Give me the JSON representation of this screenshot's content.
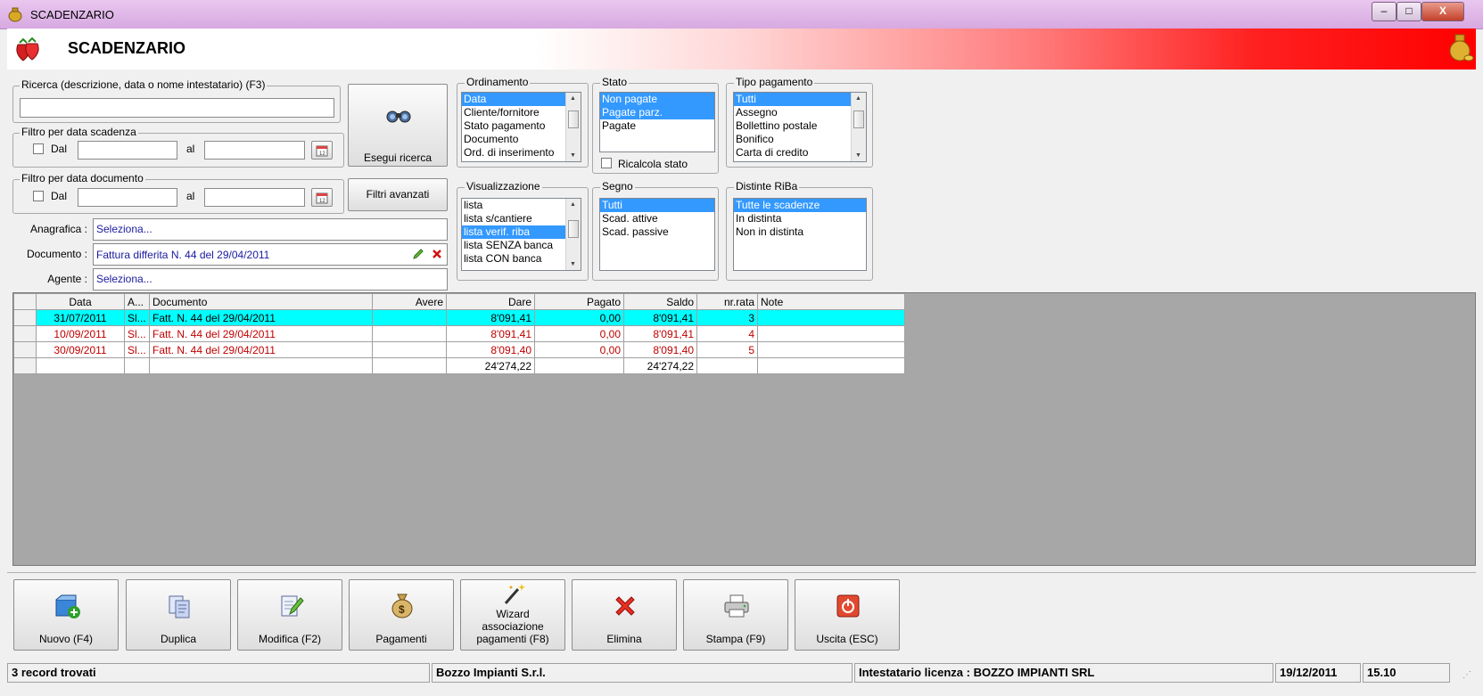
{
  "window": {
    "title": "SCADENZARIO",
    "minimize": "–",
    "maximize": "□",
    "close": "X"
  },
  "header": {
    "title": "SCADENZARIO"
  },
  "search": {
    "group_title": "Ricerca (descrizione, data o nome intestatario) (F3)",
    "value": "",
    "exec_label": "Esegui ricerca",
    "advanced_label": "Filtri avanzati"
  },
  "filter_due": {
    "title": "Filtro per data scadenza",
    "from_label": "Dal",
    "to_label": "al",
    "from_value": "",
    "to_value": "",
    "checked": false
  },
  "filter_doc": {
    "title": "Filtro per data documento",
    "from_label": "Dal",
    "to_label": "al",
    "from_value": "",
    "to_value": "",
    "checked": false
  },
  "fields": {
    "anagrafica": {
      "label": "Anagrafica :",
      "value": "Seleziona..."
    },
    "documento": {
      "label": "Documento :",
      "value": "Fattura differita N. 44 del 29/04/2011"
    },
    "agente": {
      "label": "Agente :",
      "value": "Seleziona..."
    }
  },
  "ordinamento": {
    "title": "Ordinamento",
    "items": [
      "Data",
      "Cliente/fornitore",
      "Stato pagamento",
      "Documento",
      "Ord. di inserimento"
    ],
    "selected": [
      0
    ]
  },
  "stato": {
    "title": "Stato",
    "items": [
      "Non pagate",
      "Pagate parz.",
      "Pagate"
    ],
    "selected": [
      0,
      1
    ],
    "recalc_label": "Ricalcola stato",
    "recalc_checked": false
  },
  "tipo_pagamento": {
    "title": "Tipo pagamento",
    "items": [
      "Tutti",
      "Assegno",
      "Bollettino postale",
      "Bonifico",
      "Carta di credito"
    ],
    "selected": [
      0
    ]
  },
  "visualizzazione": {
    "title": "Visualizzazione",
    "items": [
      "lista",
      "lista s/cantiere",
      "lista verif. riba",
      "lista SENZA banca",
      "lista CON banca"
    ],
    "selected": [
      2
    ]
  },
  "segno": {
    "title": "Segno",
    "items": [
      "Tutti",
      "Scad. attive",
      "Scad. passive"
    ],
    "selected": [
      0
    ]
  },
  "distinte": {
    "title": "Distinte RiBa",
    "items": [
      "Tutte le scadenze",
      "In distinta",
      "Non in distinta"
    ],
    "selected": [
      0
    ]
  },
  "table": {
    "columns": [
      "",
      "Data",
      "A...",
      "Documento",
      "Avere",
      "Dare",
      "Pagato",
      "Saldo",
      "nr.rata",
      "Note"
    ],
    "rows": [
      {
        "data": "31/07/2011",
        "a": "Sl...",
        "documento": "Fatt. N. 44 del 29/04/2011",
        "avere": "",
        "dare": "8'091,41",
        "pagato": "0,00",
        "saldo": "8'091,41",
        "rata": "3",
        "note": "",
        "highlight": true
      },
      {
        "data": "10/09/2011",
        "a": "Sl...",
        "documento": "Fatt. N. 44 del 29/04/2011",
        "avere": "",
        "dare": "8'091,41",
        "pagato": "0,00",
        "saldo": "8'091,41",
        "rata": "4",
        "note": "",
        "highlight": false
      },
      {
        "data": "30/09/2011",
        "a": "Sl...",
        "documento": "Fatt. N. 44 del 29/04/2011",
        "avere": "",
        "dare": "8'091,40",
        "pagato": "0,00",
        "saldo": "8'091,40",
        "rata": "5",
        "note": "",
        "highlight": false
      }
    ],
    "totals": {
      "dare": "24'274,22",
      "saldo": "24'274,22"
    }
  },
  "toolbar": [
    {
      "label": "Nuovo (F4)",
      "icon": "new-icon"
    },
    {
      "label": "Duplica",
      "icon": "duplicate-icon"
    },
    {
      "label": "Modifica (F2)",
      "icon": "edit-icon"
    },
    {
      "label": "Pagamenti",
      "icon": "money-bag-icon"
    },
    {
      "label": "Wizard associazione pagamenti (F8)",
      "icon": "wizard-wand-icon"
    },
    {
      "label": "Elimina",
      "icon": "delete-icon"
    },
    {
      "label": "Stampa (F9)",
      "icon": "printer-icon"
    },
    {
      "label": "Uscita (ESC)",
      "icon": "exit-icon"
    }
  ],
  "status": {
    "records": "3 record trovati",
    "company": "Bozzo Impianti S.r.l.",
    "license": "Intestatario licenza : BOZZO IMPIANTI SRL",
    "date": "19/12/2011",
    "time": "15.10"
  },
  "colors": {
    "header_red": "#ff0000",
    "row_highlight": "#00ffff",
    "list_selection": "#3399ff",
    "row_text_red": "#c00000"
  }
}
